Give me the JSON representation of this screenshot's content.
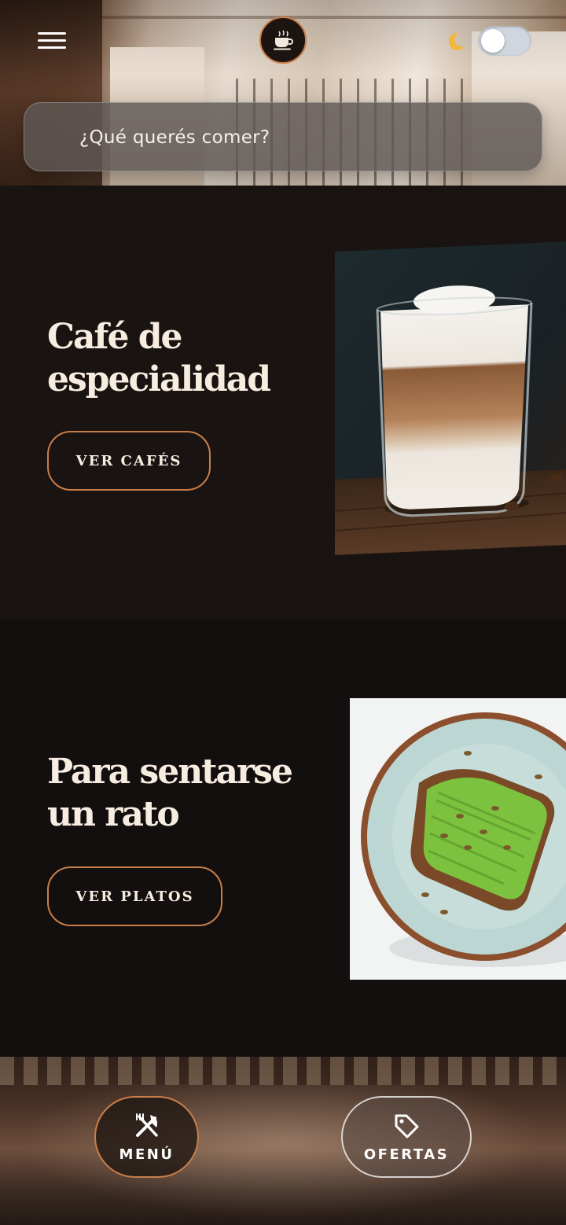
{
  "header": {
    "search": {
      "placeholder": "¿Qué querés comer?",
      "value": ""
    },
    "dark_mode_toggle": {
      "on": false
    }
  },
  "sections": [
    {
      "title": "Café de especialidad",
      "button_label": "VER CAFÉS"
    },
    {
      "title": "Para sentarse un rato",
      "button_label": "VER PLATOS"
    }
  ],
  "bottom_nav": {
    "menu_label": "MENÚ",
    "offers_label": "OFERTAS"
  },
  "colors": {
    "accent": "#c97e48",
    "background": "#191311",
    "text": "#f7ece0"
  },
  "icons": {
    "header_left": "hamburger-menu-icon",
    "logo": "coffee-cup-icon",
    "theme": "moon-icon",
    "menu": "fork-knife-icon",
    "offers": "price-tag-icon"
  }
}
